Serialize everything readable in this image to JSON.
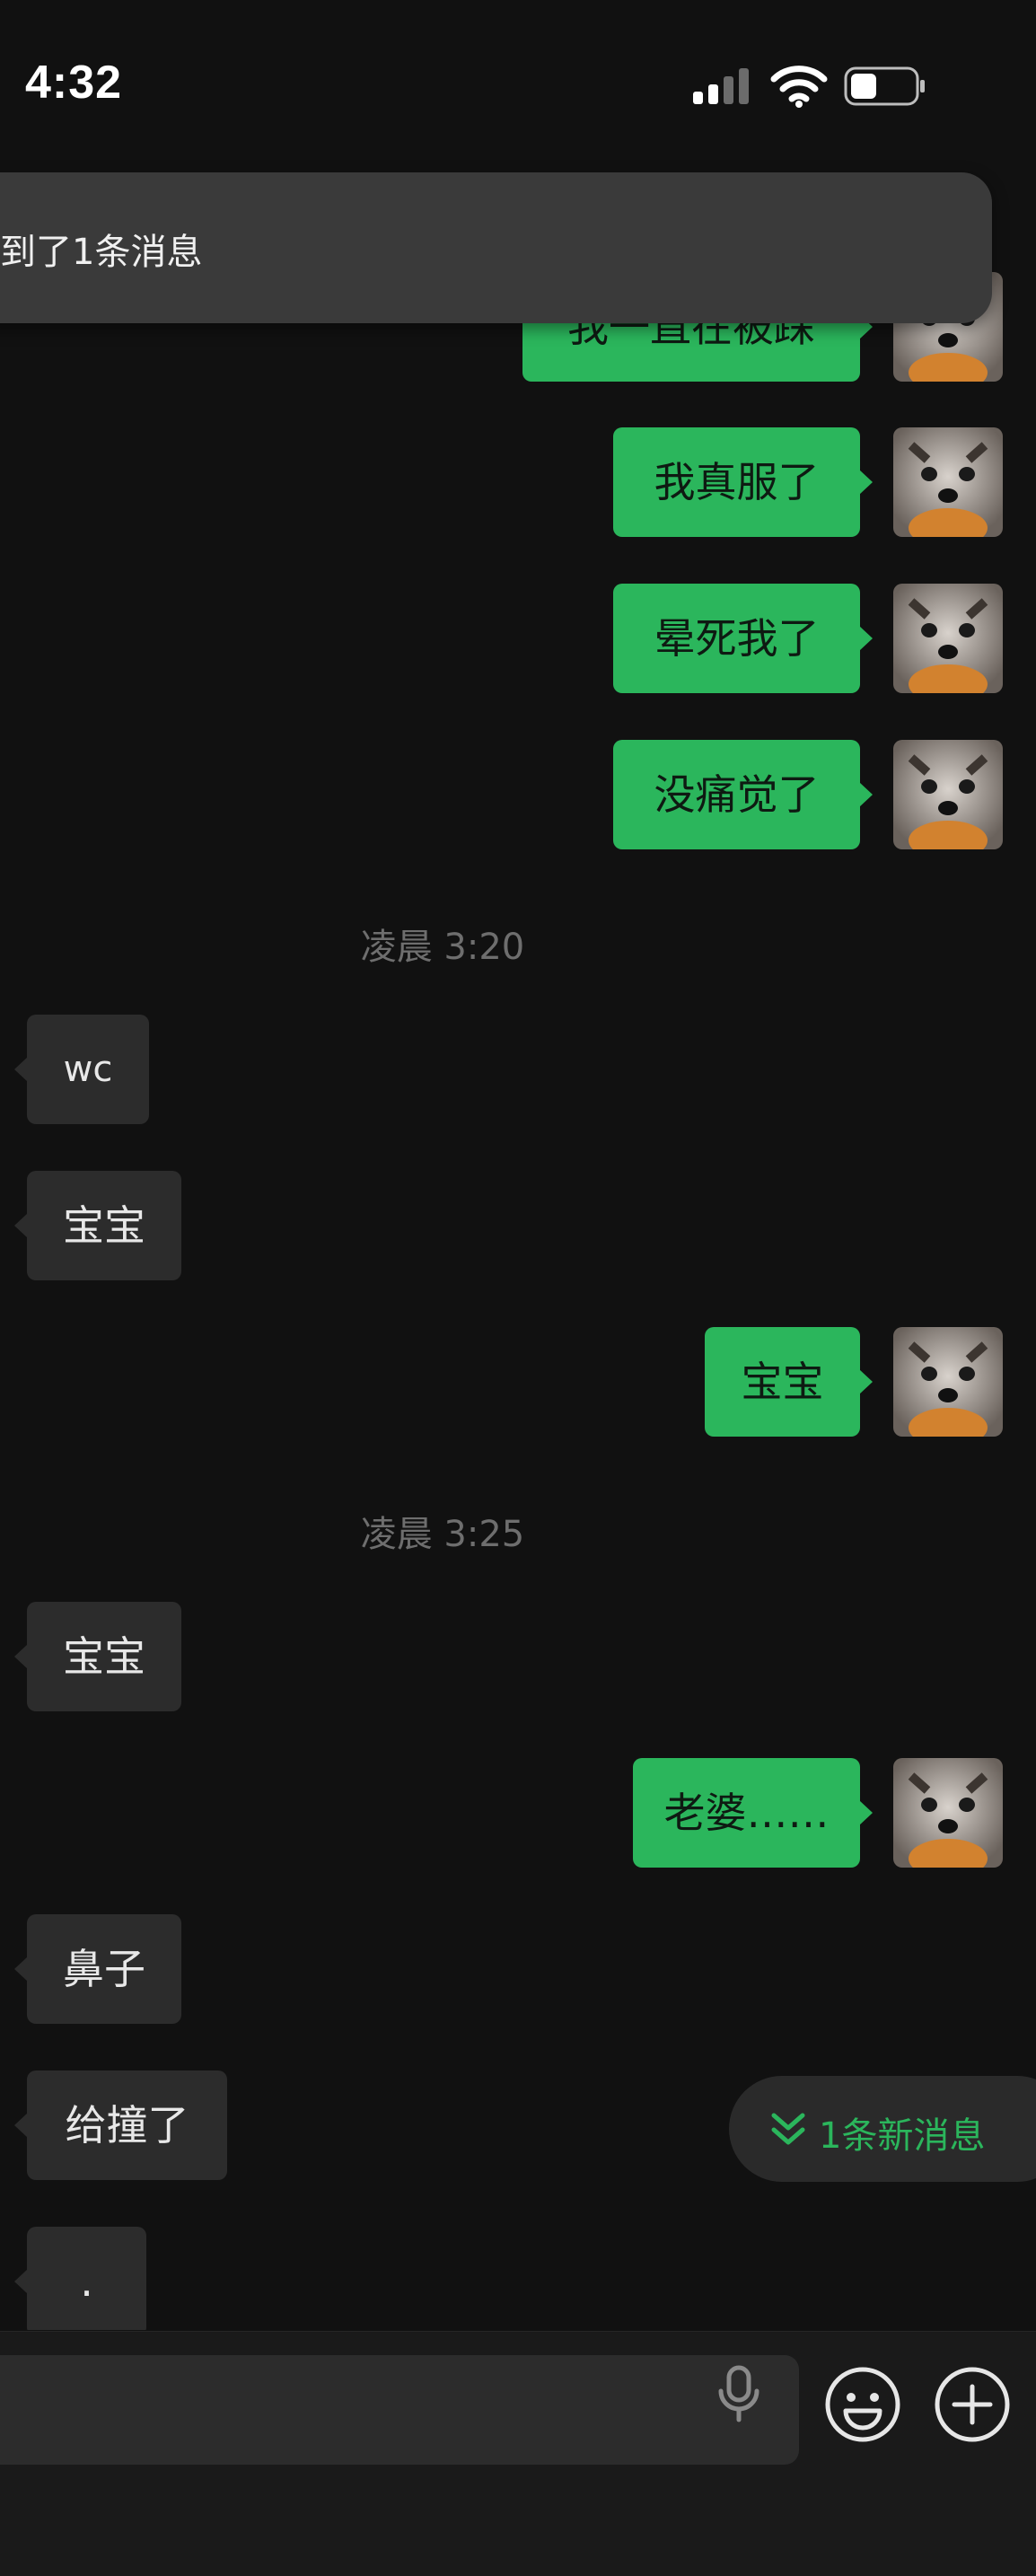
{
  "status_bar": {
    "time": "4:32"
  },
  "notification_banner": {
    "text": "到了1条消息"
  },
  "messages": [
    {
      "direction": "out",
      "text": "我一直在被踩"
    },
    {
      "direction": "out",
      "text": "我真服了"
    },
    {
      "direction": "out",
      "text": "晕死我了"
    },
    {
      "direction": "out",
      "text": "没痛觉了"
    },
    {
      "type": "timestamp",
      "text": "凌晨 3:20"
    },
    {
      "direction": "in",
      "text": "wc"
    },
    {
      "direction": "in",
      "text": "宝宝"
    },
    {
      "direction": "out",
      "text": "宝宝"
    },
    {
      "type": "timestamp",
      "text": "凌晨 3:25"
    },
    {
      "direction": "in",
      "text": "宝宝"
    },
    {
      "direction": "out",
      "text": "老婆……"
    },
    {
      "direction": "in",
      "text": "鼻子"
    },
    {
      "direction": "in",
      "text": "给撞了"
    },
    {
      "direction": "in",
      "text": "."
    }
  ],
  "new_messages_pill": {
    "label": "1条新消息",
    "icon": "double-chevron-down-icon"
  },
  "input_bar": {
    "mic_icon": "microphone-icon",
    "emoji_icon": "emoji-icon",
    "plus_icon": "plus-circle-icon"
  },
  "colors": {
    "background": "#111111",
    "outgoing_bubble": "#2bb65c",
    "incoming_bubble": "#2c2c2c",
    "accent": "#2bb65c"
  }
}
